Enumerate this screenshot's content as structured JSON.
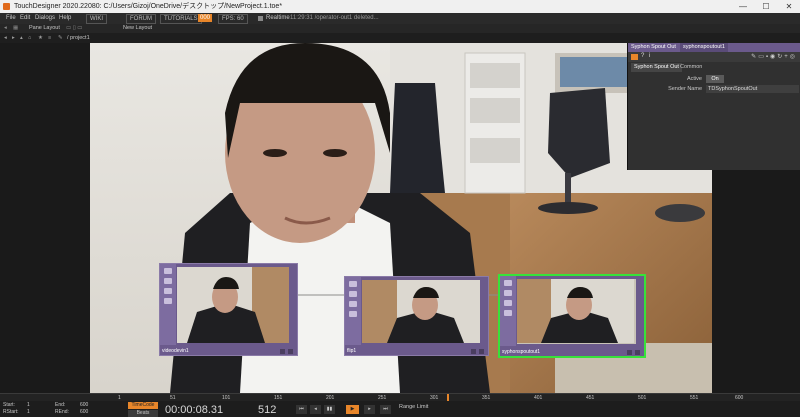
{
  "window": {
    "title": "TouchDesigner 2020.22080: C:/Users/Gizoj/OneDrive/デスクトップ/NewProject.1.toe*",
    "minimize": "—",
    "maximize": "☐",
    "close": "✕"
  },
  "menu": {
    "items": [
      "File",
      "Edit",
      "Dialogs",
      "Help"
    ],
    "wiki": "WIKI",
    "forum": "FORUM",
    "tutorials": "TUTORIALS",
    "badge": "000",
    "fps": "FPS: 60",
    "realtime": "Realtime",
    "message": "11:29:31 /operator-out1 deleted..."
  },
  "panebar": {
    "pane_layout": "Pane Layout",
    "new_layout": "New Layout"
  },
  "pathbar": {
    "path": "/ project1",
    "crumb": "project1"
  },
  "nodes": [
    {
      "label": "videodevin1"
    },
    {
      "label": "flip1"
    },
    {
      "label": "syphonspoutout1"
    }
  ],
  "params": {
    "op_type": "Syphon Spout Out",
    "op_name": "syphonspoutout1",
    "tabs": [
      "Syphon Spout Out",
      "Common"
    ],
    "active_label": "Active",
    "active_value": "On",
    "sender_label": "Sender Name",
    "sender_value": "TDSyphonSpoutOut"
  },
  "ruler": {
    "ticks": [
      "1",
      "51",
      "101",
      "151",
      "201",
      "251",
      "301",
      "351",
      "401",
      "451",
      "501",
      "551",
      "600"
    ]
  },
  "timeline": {
    "start_label": "Start:",
    "start_value": "1",
    "end_label": "End:",
    "end_value": "600",
    "rstart_label": "RStart:",
    "rstart_value": "1",
    "rend_label": "REnd:",
    "rend_value": "600",
    "timecode_button": "TimeCode",
    "beats_button": "Beats",
    "timecode": "00:00:08.31",
    "frame": "512",
    "range_limit": "Range Limit"
  },
  "colors": {
    "op_purple": "#6b5a8c",
    "selected_green": "#37e23a",
    "accent_orange": "#e8862a"
  }
}
